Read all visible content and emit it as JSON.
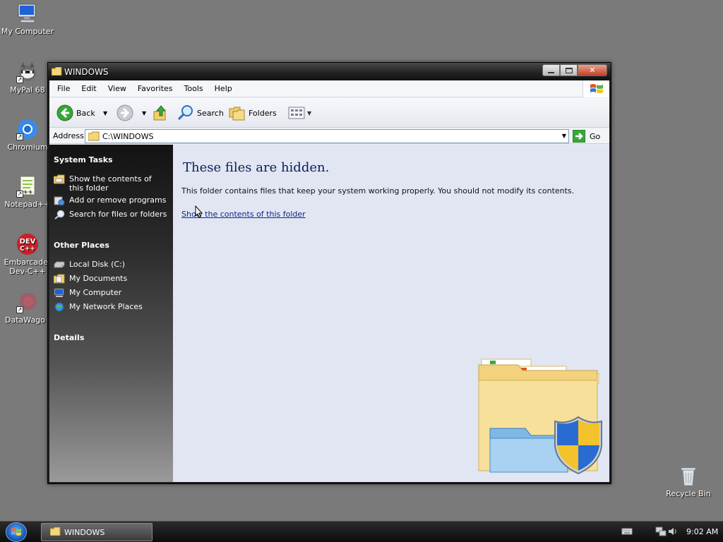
{
  "desktop": {
    "icons": [
      {
        "label": "My Computer",
        "icon": "my-computer-icon"
      },
      {
        "label": "MyPal 68",
        "icon": "mypal-icon"
      },
      {
        "label": "Chromium",
        "icon": "chromium-icon"
      },
      {
        "label": "Notepad++",
        "icon": "notepad-plus-plus-icon"
      },
      {
        "label": "Embarcadero Dev-C++",
        "line1": "Embarcader",
        "line2": "Dev-C++",
        "icon": "dev-cpp-icon"
      },
      {
        "label": "DataWago",
        "icon": "datawagon-icon"
      },
      {
        "label": "Recycle Bin",
        "icon": "recycle-bin-icon"
      }
    ]
  },
  "window": {
    "title": "WINDOWS",
    "controls": {
      "minimize": "minimize",
      "maximize": "maximize",
      "close": "close"
    },
    "menu": [
      "File",
      "Edit",
      "View",
      "Favorites",
      "Tools",
      "Help"
    ],
    "toolbar": {
      "back": "Back",
      "search": "Search",
      "folders": "Folders"
    },
    "address": {
      "label": "Address",
      "value": "C:\\WINDOWS",
      "go": "Go"
    },
    "taskpane": {
      "system_tasks": {
        "title": "System Tasks",
        "items": [
          {
            "label": "Show the contents of this folder",
            "line1": "Show the contents of",
            "line2": "this folder"
          },
          {
            "label": "Add or remove programs"
          },
          {
            "label": "Search for files or folders"
          }
        ]
      },
      "other_places": {
        "title": "Other Places",
        "items": [
          {
            "label": "Local Disk (C:)"
          },
          {
            "label": "My Documents"
          },
          {
            "label": "My Computer"
          },
          {
            "label": "My Network Places"
          }
        ]
      },
      "details": {
        "title": "Details"
      }
    },
    "content": {
      "heading": "These files are hidden.",
      "message": "This folder contains files that keep your system working properly. You should not modify its contents.",
      "link": "Show the contents of this folder"
    }
  },
  "taskbar": {
    "task_label": "WINDOWS",
    "clock": "9:02 AM"
  }
}
